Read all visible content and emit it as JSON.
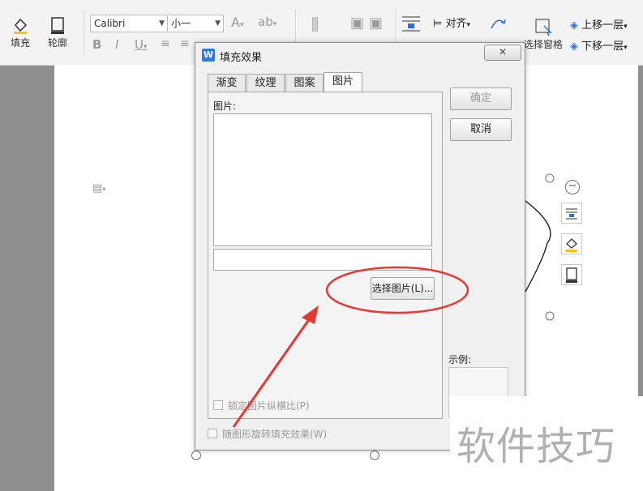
{
  "ribbon": {
    "fill_label": "填充",
    "outline_label": "轮廓",
    "font_name": "Calibri",
    "font_size": "小一",
    "align_label": "对齐",
    "selection_pane_label": "选择窗格",
    "bring_forward_label": "上移一层",
    "send_backward_label": "下移一层"
  },
  "dialog": {
    "title": "填充效果",
    "tabs": [
      {
        "label": "渐变"
      },
      {
        "label": "纹理"
      },
      {
        "label": "图案"
      },
      {
        "label": "图片"
      }
    ],
    "picture_label": "图片:",
    "select_picture_label": "选择图片(L)...",
    "lock_ratio_label": "锁定图片纵横比(P)",
    "rotate_with_shape_label": "随图形旋转填充效果(W)",
    "ok_label": "确定",
    "cancel_label": "取消",
    "example_label": "示例:"
  },
  "watermark": "软件技巧",
  "colors": {
    "annotation_red": "#e53935",
    "fill_accent": "#f5c518"
  }
}
